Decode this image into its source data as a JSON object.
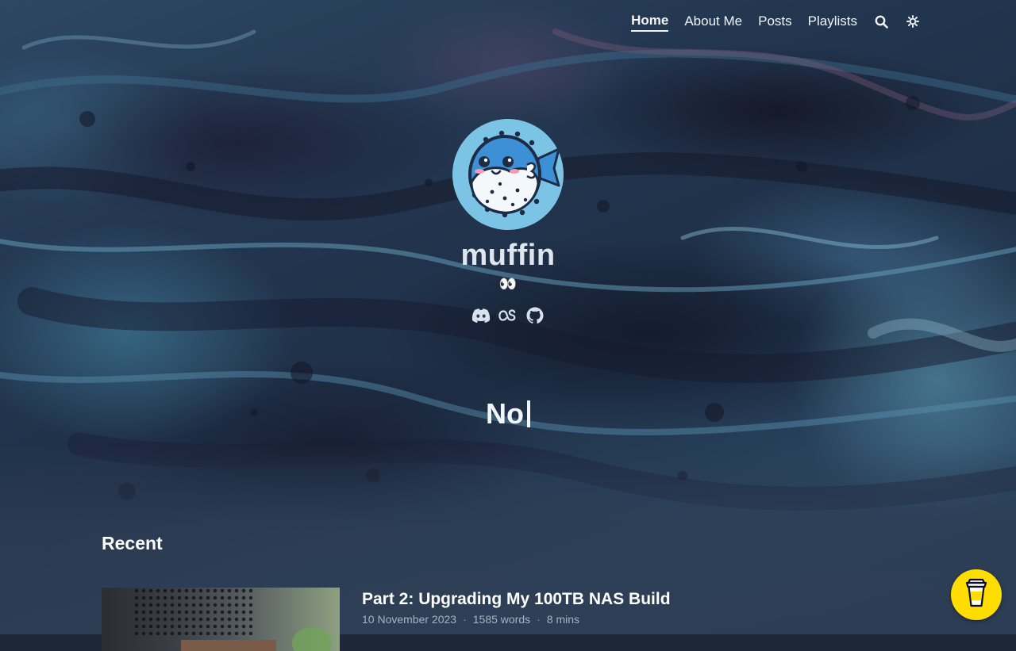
{
  "nav": {
    "links": [
      {
        "label": "Home",
        "active": true
      },
      {
        "label": "About Me",
        "active": false
      },
      {
        "label": "Posts",
        "active": false
      },
      {
        "label": "Playlists",
        "active": false
      }
    ],
    "icons": [
      "search-icon",
      "theme-toggle-icon"
    ]
  },
  "hero": {
    "avatar_icon": "pufferfish-avatar",
    "site_title": "muffin",
    "tagline": "👀",
    "socials": [
      "discord-icon",
      "lastfm-icon",
      "github-icon"
    ],
    "typed_text": "No"
  },
  "recent": {
    "heading": "Recent",
    "posts": [
      {
        "title": "Part 2: Upgrading My 100TB NAS Build",
        "date": "10 November 2023",
        "words": "1585 words",
        "read_time": "8 mins"
      }
    ]
  },
  "colors": {
    "coffee_button": "#ffdd00",
    "avatar_bg": "#7cc4e6",
    "fish_body": "#3d8fd6"
  },
  "coffee_icon": "coffee-cup-icon"
}
